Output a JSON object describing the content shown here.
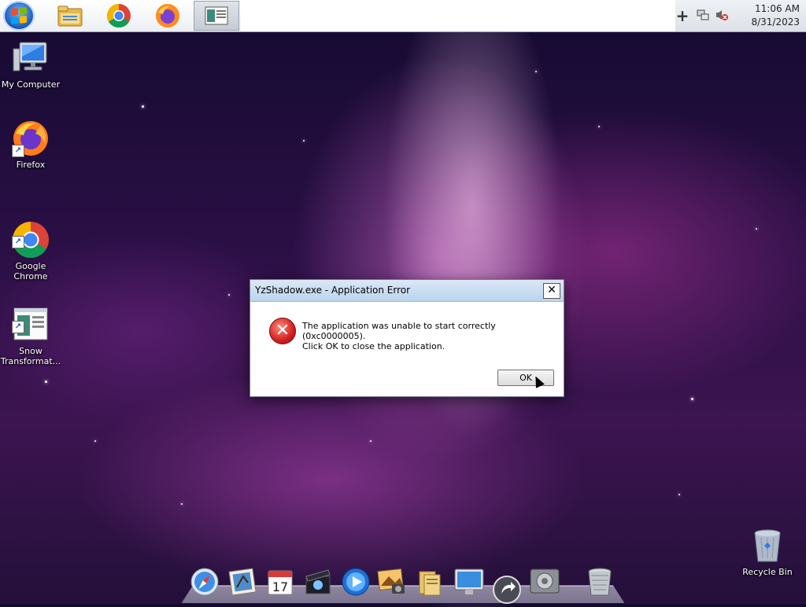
{
  "taskbar": {
    "start_icon": "windows-start-orb",
    "pinned": [
      {
        "name": "file-explorer-icon"
      },
      {
        "name": "chrome-icon"
      },
      {
        "name": "firefox-icon"
      },
      {
        "name": "snow-transformer-icon"
      }
    ],
    "tray": {
      "plus": "+",
      "clock_time": "11:06 AM",
      "clock_date": "8/31/2023"
    }
  },
  "desktop": {
    "icons": [
      {
        "label": "My Computer"
      },
      {
        "label": "Firefox"
      },
      {
        "label": "Google\nChrome"
      },
      {
        "label": "Snow\nTransformat..."
      },
      {
        "label": "Recycle Bin"
      }
    ]
  },
  "dialog": {
    "title": "YzShadow.exe - Application Error",
    "close": "✕",
    "line1": "The application was unable to start correctly (0xc0000005).",
    "line2": "Click OK to close the application.",
    "ok_label": "OK"
  },
  "dock": {
    "items": [
      "safari-icon",
      "mail-icon",
      "calendar-icon",
      "imovie-icon",
      "quicktime-icon",
      "iphoto-icon",
      "documents-folder-icon",
      "display-icon",
      "back-arrow-icon",
      "system-preferences-icon",
      "trash-icon"
    ],
    "calendar_day": "17"
  },
  "colors": {
    "taskbar": "#ffffff",
    "dialog_title": "#bcd3ee",
    "error_red": "#d21f1f"
  }
}
